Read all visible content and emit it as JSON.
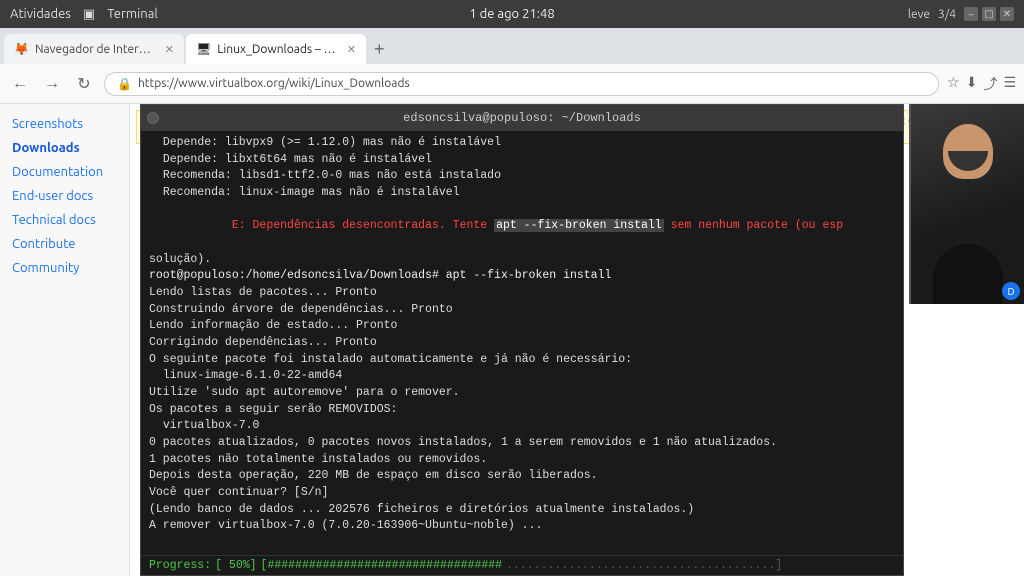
{
  "system_bar": {
    "left_items": [
      "Atividades"
    ],
    "app_name": "Terminal",
    "datetime": "1 de ago  21:48",
    "right_label": "leve",
    "page_count": "3/4"
  },
  "browser": {
    "tabs": [
      {
        "id": "firefox-tab",
        "icon": "🦊",
        "title": "Navegador de Internet G...",
        "active": false
      },
      {
        "id": "virtualbox-tab",
        "icon": "🖥",
        "title": "Linux_Downloads – Oracl...",
        "active": true
      }
    ],
    "new_tab_label": "+",
    "url": "https://www.virtualbox.org/wiki/Linux_Downloads",
    "nav": {
      "back": "←",
      "forward": "→",
      "reload": "↻"
    }
  },
  "sidebar": {
    "items": [
      {
        "id": "screenshots",
        "label": "Screenshots"
      },
      {
        "id": "downloads",
        "label": "Downloads"
      },
      {
        "id": "documentation",
        "label": "Documentation"
      },
      {
        "id": "end-user-docs",
        "label": "End-user docs"
      },
      {
        "id": "technical-docs",
        "label": "Technical docs"
      },
      {
        "id": "contribute",
        "label": "Contribute"
      },
      {
        "id": "community",
        "label": "Community"
      }
    ]
  },
  "terminal": {
    "title": "edsoncsilva@populoso: ~/Downloads",
    "lines": [
      {
        "type": "normal",
        "text": "  Depende: libvpx9 (>= 1.12.0) mas não é instalável"
      },
      {
        "type": "normal",
        "text": "  Depende: libxt6t64 mas não é instalável"
      },
      {
        "type": "normal",
        "text": "  Recomenda: libsd1-ttf2.0-0 mas não está instalado"
      },
      {
        "type": "normal",
        "text": "  Recomenda: linux-image mas não é instalável"
      },
      {
        "type": "error",
        "text": "E: Dependências desencontradas. Tente ",
        "highlight": "apt --fix-broken install",
        "suffix": " sem nenhum pacote (ou esp"
      },
      {
        "type": "normal",
        "text": "solução)."
      },
      {
        "type": "prompt",
        "text": "root@populoso:/home/edsoncsilva/Downloads# apt --fix-broken install"
      },
      {
        "type": "normal",
        "text": "Lendo listas de pacotes... Pronto"
      },
      {
        "type": "normal",
        "text": "Construindo árvore de dependências... Pronto"
      },
      {
        "type": "normal",
        "text": "Lendo informação de estado... Pronto"
      },
      {
        "type": "normal",
        "text": "Corrigindo dependências... Pronto"
      },
      {
        "type": "normal",
        "text": "O seguinte pacote foi instalado automaticamente e já não é necessário:"
      },
      {
        "type": "indent",
        "text": "  linux-image-6.1.0-22-amd64"
      },
      {
        "type": "normal",
        "text": "Utilize 'sudo apt autoremove' para o remover."
      },
      {
        "type": "normal",
        "text": "Os pacotes a seguir serão REMOVIDOS:"
      },
      {
        "type": "indent",
        "text": "  virtualbox-7.0"
      },
      {
        "type": "normal",
        "text": "0 pacotes atualizados, 0 pacotes novos instalados, 1 a serem removidos e 1 não atualizados."
      },
      {
        "type": "normal",
        "text": "1 pacotes não totalmente instalados ou removidos."
      },
      {
        "type": "normal",
        "text": "Depois desta operação, 220 MB de espaço em disco serão liberados."
      },
      {
        "type": "normal",
        "text": "Você quer continuar? [S/n]"
      },
      {
        "type": "normal",
        "text": "(Lendo banco de dados ... 202576 ficheiros e diretórios atualmente instalados.)"
      },
      {
        "type": "normal",
        "text": "A remover virtualbox-7.0 (7.0.20-163906~Ubuntu~noble) ..."
      }
    ],
    "progress": {
      "label": "Progress:",
      "percent": 50,
      "text": "[ 50%]",
      "bar_filled": "[##################################",
      "bar_empty": ".......................................]"
    }
  },
  "webcam": {
    "label": "webcam-overlay"
  }
}
